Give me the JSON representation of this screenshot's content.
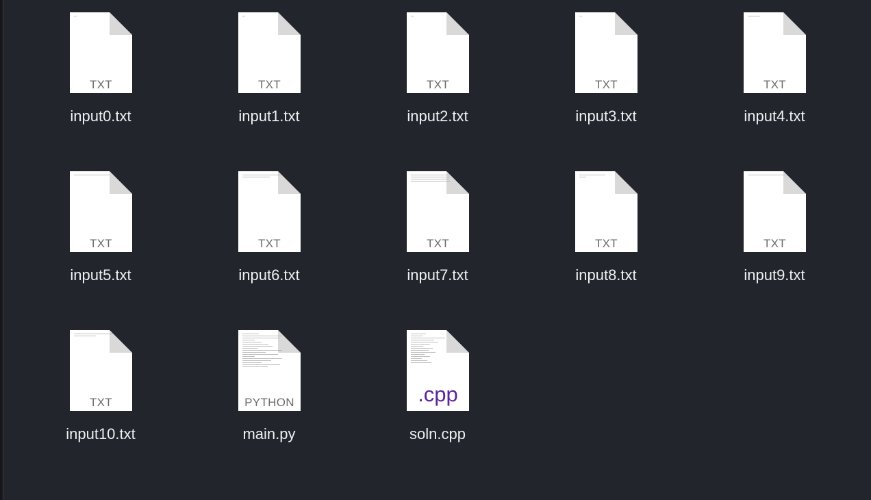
{
  "files": [
    {
      "name": "input0.txt",
      "type_label": "TXT"
    },
    {
      "name": "input1.txt",
      "type_label": "TXT"
    },
    {
      "name": "input2.txt",
      "type_label": "TXT"
    },
    {
      "name": "input3.txt",
      "type_label": "TXT"
    },
    {
      "name": "input4.txt",
      "type_label": "TXT"
    },
    {
      "name": "input5.txt",
      "type_label": "TXT"
    },
    {
      "name": "input6.txt",
      "type_label": "TXT"
    },
    {
      "name": "input7.txt",
      "type_label": "TXT"
    },
    {
      "name": "input8.txt",
      "type_label": "TXT"
    },
    {
      "name": "input9.txt",
      "type_label": "TXT"
    },
    {
      "name": "input10.txt",
      "type_label": "TXT"
    },
    {
      "name": "main.py",
      "type_label": "PYTHON"
    },
    {
      "name": "soln.cpp",
      "type_label": ".cpp"
    }
  ],
  "icons": {
    "txt": "text-file-icon",
    "python": "python-file-icon",
    "cpp": "cpp-file-icon"
  },
  "colors": {
    "background": "#22252c",
    "file_name": "#eef0f2",
    "file_type_label": "#6b6b6b",
    "cpp_label": "#5b259b"
  }
}
